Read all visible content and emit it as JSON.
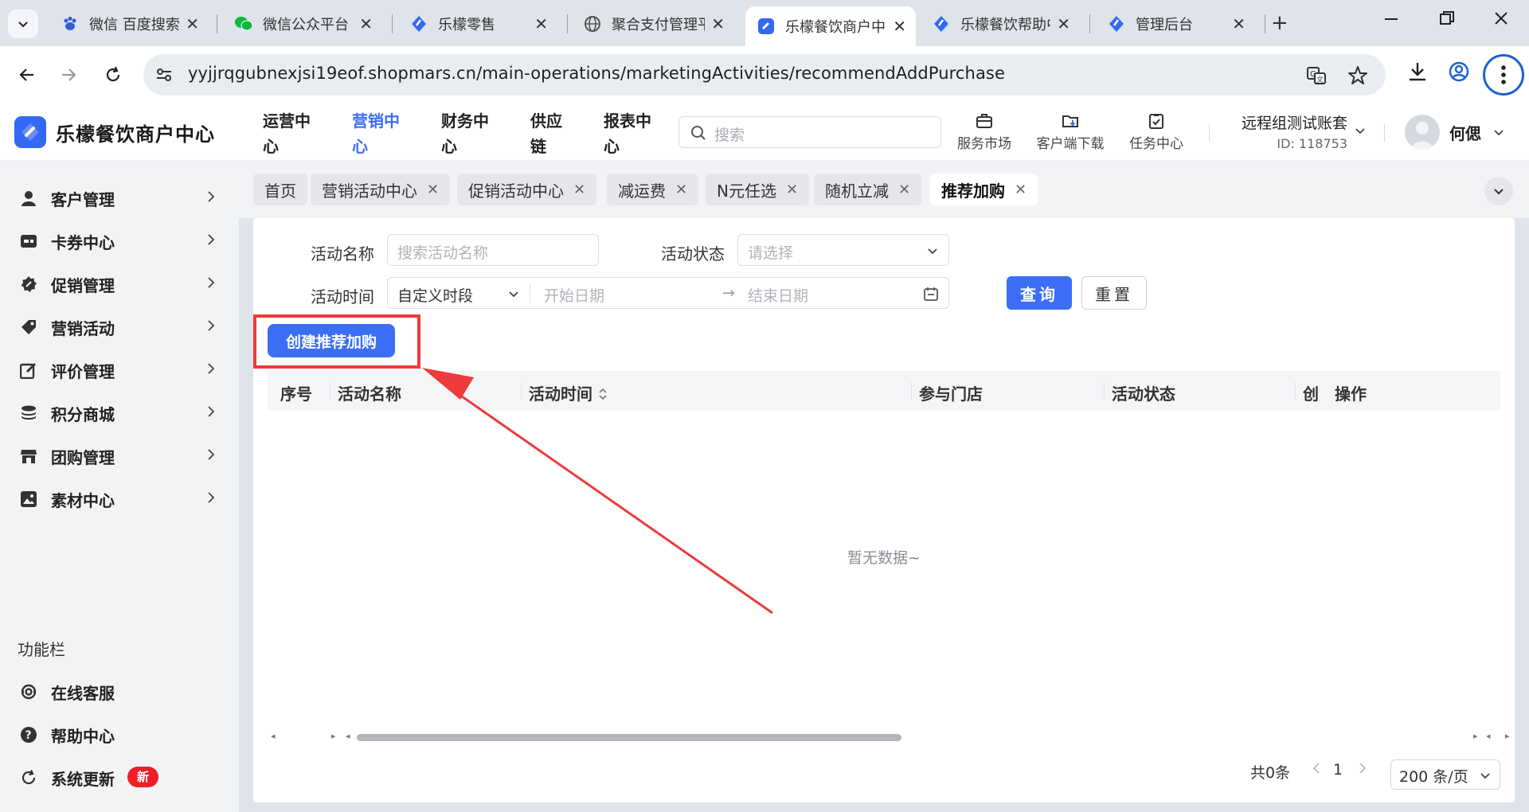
{
  "browser": {
    "tabs": [
      {
        "title": "微信 百度搜索",
        "icon": "baidu-paw-icon"
      },
      {
        "title": "微信公众平台",
        "icon": "wechat-icon"
      },
      {
        "title": "乐檬零售",
        "icon": "lemon-logo-icon"
      },
      {
        "title": "聚合支付管理平台",
        "icon": "globe-icon"
      },
      {
        "title": "乐檬餐饮商户中心",
        "icon": "lemon-logo-icon",
        "active": true
      },
      {
        "title": "乐檬餐饮帮助中心",
        "icon": "lemon-logo-icon"
      },
      {
        "title": "管理后台",
        "icon": "lemon-logo-icon"
      }
    ],
    "url": "yyjjrqgubnexjsi19eof.shopmars.cn/main-operations/marketingActivities/recommendAddPurchase"
  },
  "header": {
    "logo_text": "乐檬餐饮商户中心",
    "nav": [
      {
        "line1": "运营中",
        "line2": "心",
        "active": false
      },
      {
        "line1": "营销中",
        "line2": "心",
        "active": true
      },
      {
        "line1": "财务中",
        "line2": "心",
        "active": false
      },
      {
        "line1": "供应",
        "line2": "链",
        "active": false
      },
      {
        "line1": "报表中",
        "line2": "心",
        "active": false
      }
    ],
    "search_placeholder": "搜索",
    "service_market": "服务市场",
    "client_download": "客户端下载",
    "task_center": "任务中心",
    "account_name": "远程组测试账套",
    "account_id": "ID: 118753",
    "user_name": "何偲"
  },
  "sidebar": {
    "items": [
      {
        "label": "客户管理",
        "icon": "user-icon"
      },
      {
        "label": "卡券中心",
        "icon": "card-icon"
      },
      {
        "label": "促销管理",
        "icon": "promotion-icon"
      },
      {
        "label": "营销活动",
        "icon": "tag-icon"
      },
      {
        "label": "评价管理",
        "icon": "edit-icon"
      },
      {
        "label": "积分商城",
        "icon": "coins-icon"
      },
      {
        "label": "团购管理",
        "icon": "store-icon"
      },
      {
        "label": "素材中心",
        "icon": "image-icon"
      }
    ],
    "section_title": "功能栏",
    "bottom_items": [
      {
        "label": "在线客服",
        "icon": "headset-icon"
      },
      {
        "label": "帮助中心",
        "icon": "help-icon"
      },
      {
        "label": "系统更新",
        "icon": "refresh-icon"
      }
    ],
    "new_badge": "新"
  },
  "page_tabs": [
    "首页",
    "营销活动中心",
    "促销活动中心",
    "减运费",
    "N元任选",
    "随机立减",
    "推荐加购"
  ],
  "filters": {
    "name_label": "活动名称",
    "name_placeholder": "搜索活动名称",
    "status_label": "活动状态",
    "status_placeholder": "请选择",
    "time_label": "活动时间",
    "time_mode": "自定义时段",
    "start_placeholder": "开始日期",
    "range_sep": "→",
    "end_placeholder": "结束日期",
    "query_btn": "查询",
    "reset_btn": "重置"
  },
  "create_btn": "创建推荐加购",
  "table": {
    "columns": [
      "序号",
      "活动名称",
      "活动时间",
      "参与门店",
      "活动状态",
      "创",
      "操作"
    ],
    "empty_text": "暂无数据~"
  },
  "pagination": {
    "total": "共0条",
    "page": "1",
    "page_size": "200 条/页"
  },
  "colors": {
    "primary": "#3b6ef5",
    "annotation_red": "#ee3b3b",
    "badge_red": "#ee1e28"
  }
}
